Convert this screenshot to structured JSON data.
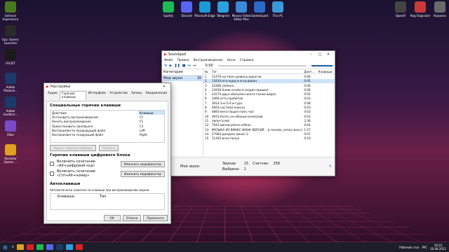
{
  "desktop": {
    "left_icons": [
      {
        "label": "GeForce Experience",
        "color": "#4a7a1e"
      },
      {
        "label": "Epic Games Launcher",
        "color": "#2a2a2a"
      },
      {
        "label": "FACEIT",
        "color": "#1a1a1a"
      },
      {
        "label": "Adobe Photosh...",
        "color": "#1b3a6a"
      },
      {
        "label": "Adobe Audition...",
        "color": "#1b3a6a"
      },
      {
        "label": "Viber",
        "color": "#7a4ac8"
      },
      {
        "label": "Rockstar Games ...",
        "color": "#e0a020"
      }
    ],
    "top_icons": [
      {
        "label": "Spotify",
        "color": "#1db954"
      },
      {
        "label": "Discord",
        "color": "#5865f2"
      },
      {
        "label": "Microsoft Edge",
        "color": "#1b9ad6"
      },
      {
        "label": "Telegram",
        "color": "#2aa1de"
      },
      {
        "label": "Movavi Video Editor Plus",
        "color": "#3a8ad8"
      },
      {
        "label": "GameGuard",
        "color": "#2a6ac8"
      },
      {
        "label": "This PC",
        "color": "#3a9ad8"
      }
    ],
    "right_icons": [
      {
        "label": "OpenIV",
        "color": "#444444"
      },
      {
        "label": "Reg Organizer",
        "color": "#c83a3a"
      },
      {
        "label": "Корзина",
        "color": "#6a6a6a"
      }
    ]
  },
  "player": {
    "title": "Soundpad",
    "menu": [
      "Файл",
      "Правка",
      "Воспроизведение",
      "Окно",
      "Справка"
    ],
    "time": "0:00",
    "cat_header": "Категория",
    "cat_count_header": "",
    "categories": [
      {
        "name": "Мои звуки",
        "count": "15"
      }
    ],
    "columns": [
      "№",
      "Тег",
      "Длит...",
      "Клавиши"
    ],
    "rows": [
      {
        "n": "1",
        "tag": "11470-не-твое-уровень-дорогая",
        "dur": "0:06"
      },
      {
        "n": "2",
        "tag": "13434-кто-куда-а-я-на-диван",
        "dur": "0:05"
      },
      {
        "n": "3",
        "tag": "21666-sildeera",
        "dur": "0:06"
      },
      {
        "n": "4",
        "tag": "23930-ближ-сечём-я-скорее-пришел",
        "dur": "0:06"
      },
      {
        "n": "5",
        "tag": "24275-двух-обезьяне-некто-также-видел",
        "dur": "0:05"
      },
      {
        "n": "6",
        "tag": "3466-есть-пробитие",
        "dur": "0:03"
      },
      {
        "n": "7",
        "tag": "3914-3-и-5-0-и-гура",
        "dur": "0:08"
      },
      {
        "n": "8",
        "tag": "4663-система-поиска",
        "dur": "0:03"
      },
      {
        "n": "9",
        "tag": "4893-мега-пощел-пить-чае",
        "dur": "0:03"
      },
      {
        "n": "10",
        "tag": "4931-блять-он-ебаные-кнопками",
        "dur": "0:03"
      },
      {
        "n": "11",
        "tag": "пипи-гулей",
        "dur": "2:36"
      },
      {
        "n": "12",
        "tag": "7041-винни-phone edition",
        "dur": "0:04"
      },
      {
        "n": "13",
        "tag": "МУЗЫКА ИЗ ВИНКС ФОНК ВЕРСИЯ ...b remake_remix) bass boosted",
        "dur": "1:57"
      },
      {
        "n": "14",
        "tag": "27664-дендиес-винкс-2",
        "dur": "0:07"
      },
      {
        "n": "15",
        "tag": "11403-всех-пенуе",
        "dur": "0:10"
      }
    ],
    "footer": {
      "name": "Мои звуки",
      "sounds_label": "Звуков:",
      "sounds": "15",
      "counter_label": "Счетчик:",
      "counter": "258",
      "selected_label": "Выбрано:",
      "selected": "1"
    }
  },
  "settings": {
    "title": "Настройки",
    "tabs": [
      "Аудио",
      "Горячие клавиши",
      "Интерфейс",
      "Устройства",
      "Запись",
      "Уведомления"
    ],
    "section1": "Специальные горячие клавиши",
    "col_action": "Действие",
    "col_key": "Клавиша",
    "hotkeys": [
      {
        "action": "Остановить воспроизведение",
        "key": "F2"
      },
      {
        "action": "Начать воспроизведение",
        "key": "F1"
      },
      {
        "action": "Приостановить (вкл/выкл)",
        "key": "F3"
      },
      {
        "action": "Воспроизвести предыдущий файл",
        "key": "Left"
      },
      {
        "action": "Воспроизвести следующий файл",
        "key": "Right"
      }
    ],
    "assign_btn": "Задать горячую клавишу",
    "remove_btn": "Удалить",
    "section2": "Горячие клавиши цифрового блока",
    "num1": "Включить сочетание «Alt+цифровой код»",
    "num2": "Включить сочетание «Ctrl+Alt+номер»",
    "change_btn": "Изменить модификатор",
    "section3": "Автоклавиши",
    "auto_desc": "Автоматически нажатие на клавиши при воспроизведении звуков",
    "auto_col1": "Клавиши",
    "auto_col2": "Тип",
    "ok": "OK",
    "cancel": "Отмена",
    "apply": "Применить"
  },
  "taskbar": {
    "search": "Поиск",
    "desktop_label": "Рабочий стол",
    "time": "16:23",
    "date": "16.08.2021",
    "lang": "РУС"
  }
}
